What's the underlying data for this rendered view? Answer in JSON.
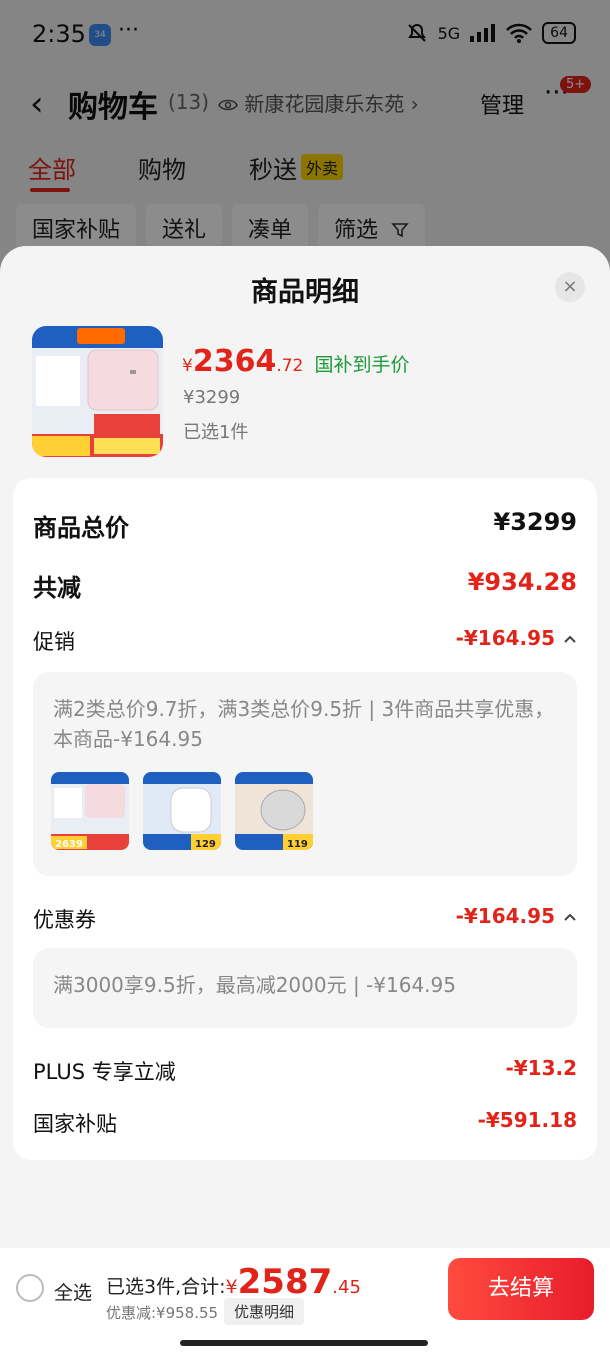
{
  "status_bar": {
    "time": "2:35",
    "app_icon_text": "34",
    "dots": "···",
    "network": "5G",
    "battery": "64"
  },
  "header": {
    "back_glyph": "‹",
    "title": "购物车",
    "count": "(13)",
    "address": "新康花园康乐东苑",
    "address_chevron": "›",
    "manage": "管理",
    "more_glyph": "···",
    "badge": "5+"
  },
  "tabs": [
    {
      "label": "全部",
      "active": true
    },
    {
      "label": "购物",
      "active": false
    },
    {
      "label": "秒送",
      "active": false,
      "tag": "外卖"
    }
  ],
  "chips": [
    "国家补贴",
    "送礼",
    "凑单",
    "筛选"
  ],
  "sheet": {
    "title": "商品明细",
    "close_glyph": "×",
    "product": {
      "price_yen": "¥",
      "price_int": "2364",
      "price_dec": ".72",
      "price_tag": "国补到手价",
      "original_price": "¥3299",
      "selected": "已选1件"
    },
    "detail": {
      "total_label": "商品总价",
      "total_value": "¥3299",
      "reduce_label": "共减",
      "reduce_value": "¥934.28",
      "promo_label": "促销",
      "promo_value": "-¥164.95",
      "promo_desc": "满2类总价9.7折，满3类总价9.5折 | 3件商品共享优惠，本商品-¥164.95",
      "promo_items": [
        {
          "name": "water-heater",
          "price": "2639"
        },
        {
          "name": "rice-cooker",
          "price": "129"
        },
        {
          "name": "steamer",
          "price": "119"
        }
      ],
      "coupon_label": "优惠券",
      "coupon_value": "-¥164.95",
      "coupon_desc": "满3000享9.5折，最高减2000元 | -¥164.95",
      "plus_label": "PLUS 专享立减",
      "plus_value": "-¥13.2",
      "subsidy_label": "国家补贴",
      "subsidy_value": "-¥591.18"
    }
  },
  "bottom_bar": {
    "select_all": "全选",
    "total_prefix": "已选3件,合计:",
    "total_yen": "¥",
    "total_int": "2587",
    "total_dec": ".45",
    "discount": "优惠减:¥958.55",
    "detail_button": "优惠明细",
    "checkout": "去结算"
  },
  "colors": {
    "accent_red": "#e2231a",
    "green": "#1a9a3a",
    "sheet_bg": "#f4f4f4"
  }
}
